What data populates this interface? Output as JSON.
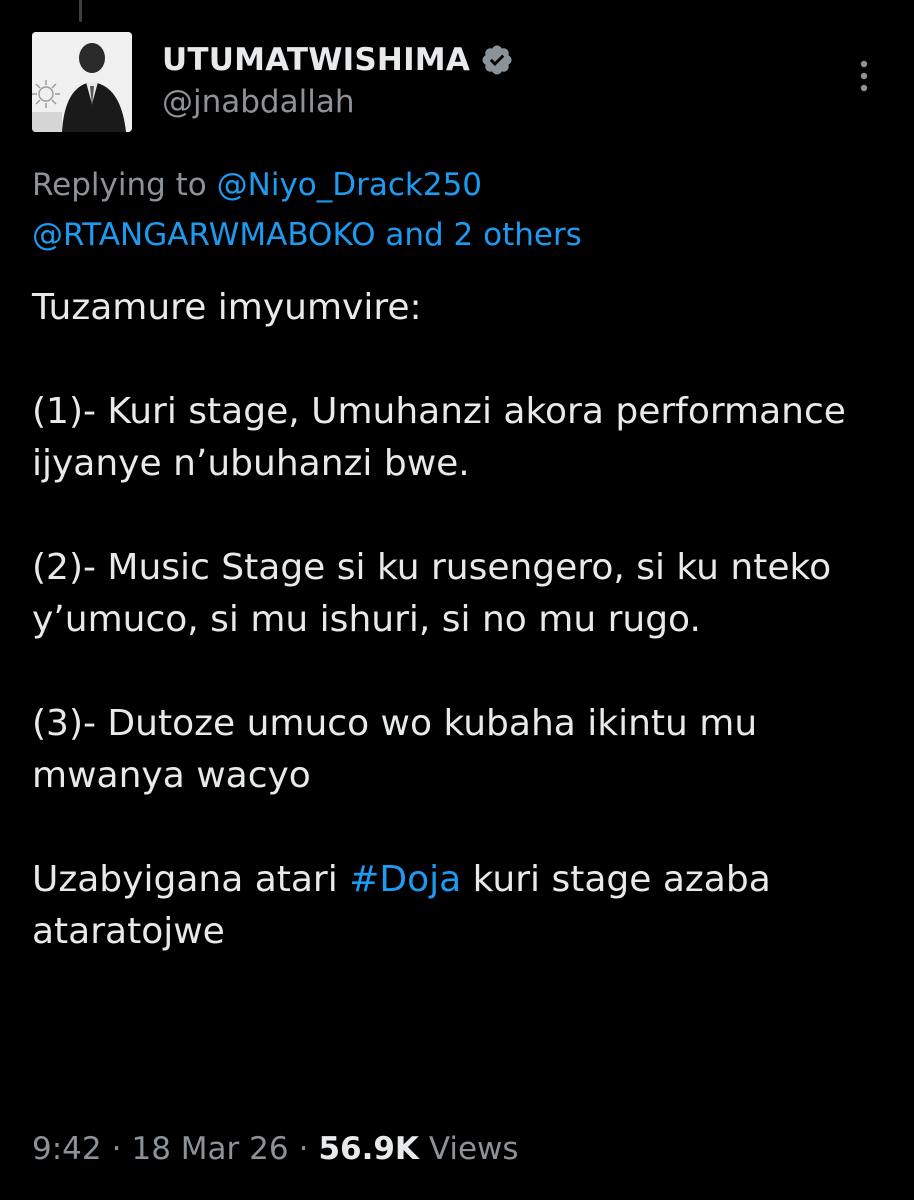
{
  "author": {
    "display_name": "UTUMATWISHIMA",
    "handle": "@jnabdallah",
    "verified": true
  },
  "icons": {
    "avatar": "profile-photo",
    "verified": "verified-badge-icon",
    "more": "more-vertical-icon"
  },
  "reply": {
    "prefix": "Replying to",
    "mention_1": "@Niyo_Drack250",
    "mention_2": "@RTANGARWMABOKO",
    "others": "and 2 others"
  },
  "body": {
    "p1": "Tuzamure imyumvire:",
    "p2": "(1)- Kuri stage, Umuhanzi akora performance ijyanye n’ubuhanzi bwe.",
    "p3": "(2)- Music Stage si ku rusengero, si ku nteko y’umuco, si mu ishuri, si no mu rugo.",
    "p4": "(3)- Dutoze umuco wo kubaha ikintu  mu mwanya wacyo",
    "p5_before": "Uzabyigana atari",
    "p5_hashtag": "#Doja",
    "p5_after": "kuri stage azaba ataratojwe"
  },
  "meta": {
    "time": "9:42",
    "date": "18 Mar 26",
    "separator": "·",
    "views_count": "56.9K",
    "views_label": "Views"
  },
  "colors": {
    "background": "#000000",
    "primary_text": "#e7e9ea",
    "secondary_text": "#8b9298",
    "link": "#1d9bf0"
  }
}
